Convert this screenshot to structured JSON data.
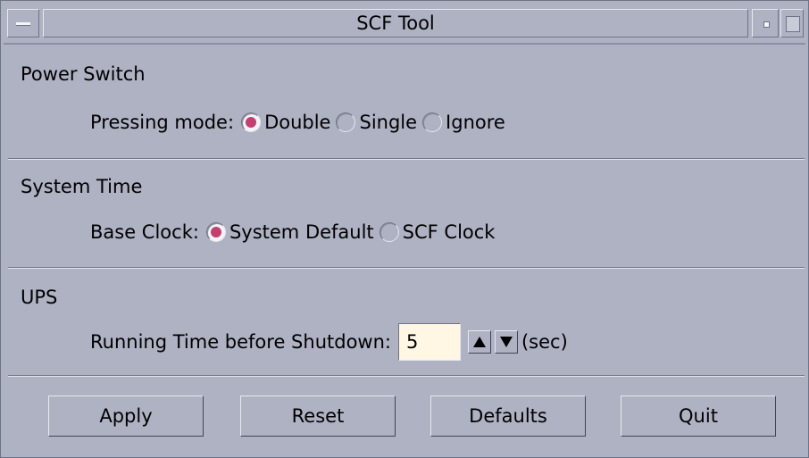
{
  "window": {
    "title": "SCF Tool"
  },
  "power_switch": {
    "heading": "Power Switch",
    "label": "Pressing mode:",
    "options": [
      "Double",
      "Single",
      "Ignore"
    ],
    "selected": "Double"
  },
  "system_time": {
    "heading": "System Time",
    "label": "Base Clock:",
    "options": [
      "System Default",
      "SCF Clock"
    ],
    "selected": "System Default"
  },
  "ups": {
    "heading": "UPS",
    "label": "Running Time before Shutdown:",
    "value": "5",
    "unit": "(sec)"
  },
  "buttons": {
    "apply": "Apply",
    "reset": "Reset",
    "defaults": "Defaults",
    "quit": "Quit"
  },
  "colors": {
    "background": "#aeb2c3",
    "radio_selected": "#c23f71",
    "input_background": "#fff6e4"
  }
}
